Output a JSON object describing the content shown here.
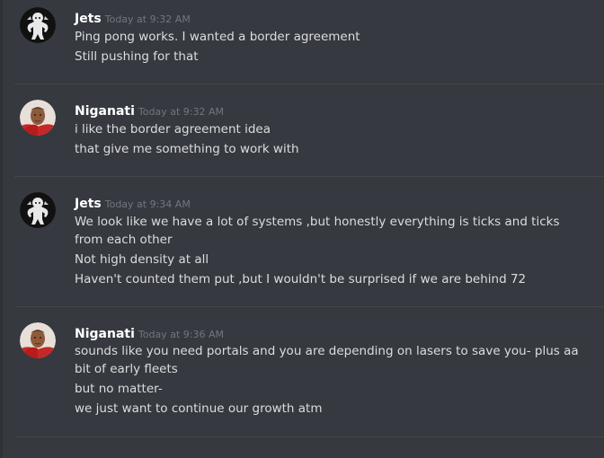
{
  "messages": [
    {
      "author": "Jets",
      "timestamp": "Today at 9:32 AM",
      "avatar_icon": "character-avatar-icon",
      "lines": [
        "Ping pong works. I wanted a border agreement",
        "Still pushing for that"
      ]
    },
    {
      "author": "Niganati",
      "timestamp": "Today at 9:32 AM",
      "avatar_icon": "person-avatar-icon",
      "lines": [
        "i like the border agreement idea",
        "that give me something to work with"
      ]
    },
    {
      "author": "Jets",
      "timestamp": "Today at 9:34 AM",
      "avatar_icon": "character-avatar-icon",
      "lines": [
        "We look like we have a lot of systems ,but honestly everything is ticks and ticks from each other",
        "Not high density at all",
        "Haven't counted them put ,but I wouldn't be surprised if we are behind 72"
      ]
    },
    {
      "author": "Niganati",
      "timestamp": "Today at 9:36 AM",
      "avatar_icon": "person-avatar-icon",
      "lines": [
        "sounds like you need portals and you are depending on lasers to save you- plus aa bit of early fleets",
        "but no matter-",
        "we just want to continue our growth atm"
      ]
    }
  ],
  "colors": {
    "background": "#36393f",
    "divider": "#42454a",
    "username": "#ffffff",
    "timestamp": "#72767d",
    "message_text": "#dcddde"
  }
}
